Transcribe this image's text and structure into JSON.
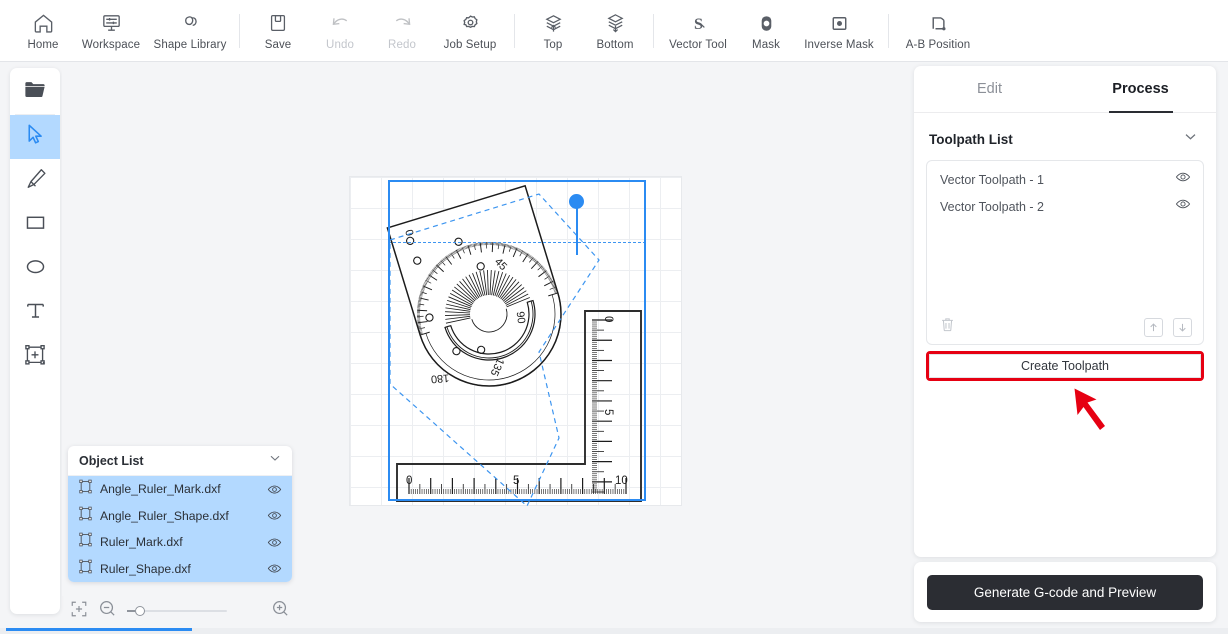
{
  "toolbar": {
    "items": [
      {
        "label": "Home",
        "icon": "home-icon",
        "disabled": false
      },
      {
        "label": "Workspace",
        "icon": "workspace-icon",
        "disabled": false
      },
      {
        "label": "Shape Library",
        "icon": "shape-library-icon",
        "disabled": false
      },
      {
        "label": "Save",
        "icon": "save-icon",
        "disabled": false
      },
      {
        "label": "Undo",
        "icon": "undo-icon",
        "disabled": true
      },
      {
        "label": "Redo",
        "icon": "redo-icon",
        "disabled": true
      },
      {
        "label": "Job Setup",
        "icon": "job-setup-icon",
        "disabled": false
      },
      {
        "label": "Top",
        "icon": "bring-to-top-icon",
        "disabled": false
      },
      {
        "label": "Bottom",
        "icon": "send-to-bottom-icon",
        "disabled": false
      },
      {
        "label": "Vector Tool",
        "icon": "vector-tool-icon",
        "disabled": false
      },
      {
        "label": "Mask",
        "icon": "mask-icon",
        "disabled": false
      },
      {
        "label": "Inverse Mask",
        "icon": "inverse-mask-icon",
        "disabled": false
      },
      {
        "label": "A-B Position",
        "icon": "ab-position-icon",
        "disabled": false
      }
    ]
  },
  "left_rail": {
    "tools": [
      {
        "name": "open-folder-tool",
        "icon": "folder-icon",
        "active": false
      },
      {
        "name": "select-tool",
        "icon": "cursor-arrow-icon",
        "active": true
      },
      {
        "name": "pen-tool",
        "icon": "pen-nib-icon",
        "active": false
      },
      {
        "name": "rectangle-tool",
        "icon": "rectangle-icon",
        "active": false
      },
      {
        "name": "ellipse-tool",
        "icon": "ellipse-icon",
        "active": false
      },
      {
        "name": "text-tool",
        "icon": "text-t-icon",
        "active": false
      },
      {
        "name": "insert-shape-tool",
        "icon": "add-frame-icon",
        "active": false
      }
    ]
  },
  "object_list": {
    "title": "Object List",
    "collapse_icon": "chevron-down-icon",
    "items": [
      {
        "name": "Angle_Ruler_Mark.dxf",
        "visible": true
      },
      {
        "name": "Angle_Ruler_Shape.dxf",
        "visible": true
      },
      {
        "name": "Ruler_Mark.dxf",
        "visible": true
      },
      {
        "name": "Ruler_Shape.dxf",
        "visible": true
      }
    ]
  },
  "zoom_bar": {
    "fit_icon": "fit-to-screen-icon",
    "zoom_out_icon": "zoom-out-icon",
    "zoom_in_icon": "zoom-in-icon"
  },
  "right_panel": {
    "tabs": [
      {
        "label": "Edit",
        "active": false
      },
      {
        "label": "Process",
        "active": true
      }
    ],
    "toolpath_section": {
      "title": "Toolpath List",
      "collapse_icon": "chevron-down-icon",
      "items": [
        {
          "name": "Vector Toolpath - 1",
          "visible_icon": "eye-icon"
        },
        {
          "name": "Vector Toolpath - 2",
          "visible_icon": "eye-icon"
        }
      ],
      "delete_icon": "trash-icon",
      "move_up_icon": "arrow-up-icon",
      "move_down_icon": "arrow-down-icon",
      "create_button": "Create Toolpath",
      "highlight_color": "#e60012"
    },
    "generate_button": "Generate G-code and Preview"
  },
  "canvas": {
    "objects": [
      {
        "name": "protractor",
        "labels": [
          "0",
          "45",
          "90",
          "135",
          "180"
        ]
      },
      {
        "name": "l-ruler",
        "horizontal_labels": [
          "0",
          "5",
          "10"
        ],
        "vertical_labels": [
          "0",
          "5"
        ]
      }
    ],
    "selection_color": "#2b8bf2"
  }
}
